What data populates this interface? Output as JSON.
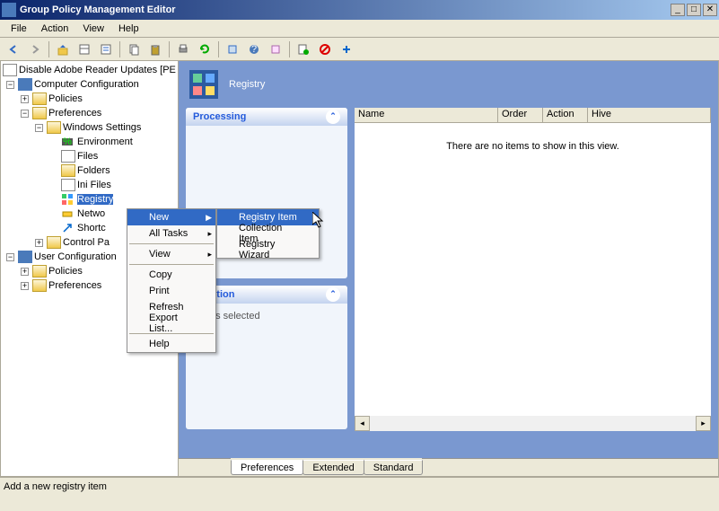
{
  "window": {
    "title": "Group Policy Management Editor"
  },
  "menu": {
    "file": "File",
    "action": "Action",
    "view": "View",
    "help": "Help"
  },
  "tree": {
    "root": "Disable Adobe Reader Updates [PE",
    "comp_cfg": "Computer Configuration",
    "policies": "Policies",
    "preferences": "Preferences",
    "win_settings": "Windows Settings",
    "environment": "Environment",
    "files": "Files",
    "folders": "Folders",
    "ini": "Ini Files",
    "registry": "Registry",
    "network": "Netwo",
    "shortcuts": "Shortc",
    "ctrl_panel": "Control Pa",
    "user_cfg": "User Configuration"
  },
  "header": {
    "title": "Registry"
  },
  "panels": {
    "processing": "Processing",
    "description": "scription",
    "desc_body": "olicies selected"
  },
  "list": {
    "col_name": "Name",
    "col_order": "Order",
    "col_action": "Action",
    "col_hive": "Hive",
    "empty": "There are no items to show in this view."
  },
  "tabs": {
    "preferences": "Preferences",
    "extended": "Extended",
    "standard": "Standard"
  },
  "ctx1": {
    "new": "New",
    "alltasks": "All Tasks",
    "view": "View",
    "copy": "Copy",
    "print": "Print",
    "refresh": "Refresh",
    "export": "Export List...",
    "help": "Help"
  },
  "ctx2": {
    "reg_item": "Registry Item",
    "coll_item": "Collection Item",
    "reg_wiz": "Registry Wizard"
  },
  "status": "Add a new registry item"
}
